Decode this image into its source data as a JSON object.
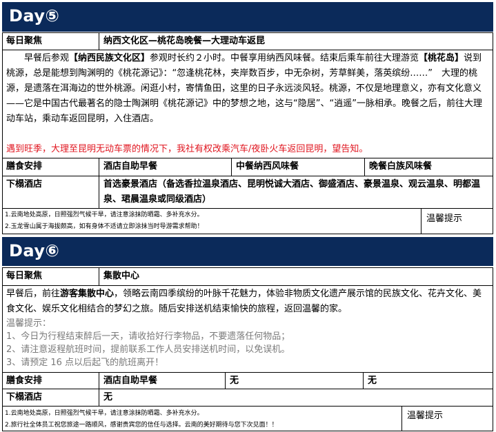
{
  "day5": {
    "title": "Day⑤",
    "focus_label": "每日聚焦",
    "focus_value": "纳西文化区—桃花岛晚餐—大理动车返昆",
    "para": [
      {
        "text": "早餐后参观"
      },
      {
        "text": "【纳西民族文化区】",
        "bold": true
      },
      {
        "text": "参观时长约２小时。中餐享用纳西风味餐。结束后乘车前往大理游览"
      },
      {
        "text": "【桃花岛】",
        "bold": true
      },
      {
        "text": "说到桃源，总是能想到陶渊明的《桃花源记》：“忽逢桃花林，夹岸数百步，中无杂树，芳草鲜美，落英缤纷……”　大理的桃源，是遗落在洱海边的世外桃源。闲逛小村，寄情鱼田，这里的日子永远淡风轻。桃源，不仅是地理意义，亦有文化意义——它是中国古代最著名的隐士陶渊明《桃花源记》中的梦想之地，这与“隐居”、“逍遥”一脉相承。晚餐之后，前往大理动车站，乘动车返回昆明，入住酒店。"
      }
    ],
    "notice": "遇到旺季，大理至昆明无动车票的情况下，我社有权改乘汽车/夜卧火车返回昆明，望告知。",
    "meal_label": "膳食安排",
    "meals": [
      "酒店自助早餐",
      "中餐纳西风味餐",
      "晚餐白族风味餐"
    ],
    "hotel_label": "下榻酒店",
    "hotel_value": "首选豪景酒店（备选香拉温泉酒店、昆明悦诚大酒店、御盛酒店、豪景温泉、观云温泉、明都温泉、珺晨温泉或同级酒店）",
    "tips": [
      "1.云南地处高原，日照强烈气候干旱，请注意涂抹防晒霜、多补充水分。",
      "2.玉龙雪山属于海拔颇高，如有身体不适请立即涂抹当时导游需求帮助！"
    ],
    "tips_label": "温馨提示"
  },
  "day6": {
    "title": "Day⑥",
    "focus_label": "每日聚焦",
    "focus_value": "集散中心",
    "para": [
      {
        "text": "早餐后，前往"
      },
      {
        "text": "游客集散中心",
        "bold": true
      },
      {
        "text": "，领略云南四季缤纷的叶脉千花魅力，体验非物质文化遗产展示馆的民族文化、花卉文化、美食文化、娱乐文化相结合的梦幻之旅。随后安排送机结束愉快的旅程，返回温馨的家。"
      }
    ],
    "warm_lines": [
      "温馨提示：",
      "1、今日为行程结束醉后一天，请收拾好行李物品，不要遗落任何物品；",
      "2、请注意返程航班时间，提前联系工作人员安排送机时间，以免误机。",
      "3、请预定 16 点以后起飞的航班离开！"
    ],
    "meal_label": "膳食安排",
    "meals": [
      "酒店自助早餐",
      "无",
      "无"
    ],
    "hotel_label": "下榻酒店",
    "hotel_value": "无",
    "tips": [
      "1.云南地处高原，日照强烈气候干旱，请注意涂抹防晒霜、多补充水分。",
      "2.旅行社全体员工祝您旅途一路顺风，感谢贵宾您的信任与选择。云南的美好期待与您下次见面！！"
    ],
    "tips_label": "温馨提示"
  },
  "colors": {
    "header_bar": "#0b2a5a",
    "notice_red": "#e0141e",
    "tip_gray": "#7a7a7a"
  }
}
